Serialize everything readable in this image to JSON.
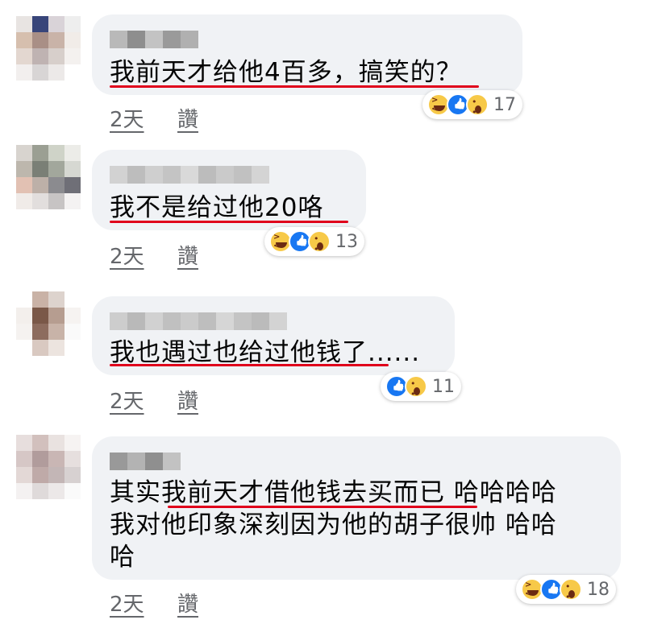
{
  "comments": [
    {
      "text": "我前天才给他4百多，搞笑的？",
      "time": "2天",
      "action": "讚",
      "reaction_count": "17",
      "reactions": [
        "haha-icon",
        "like-icon",
        "wow-icon"
      ]
    },
    {
      "text": "我不是给过他20咯",
      "time": "2天",
      "action": "讚",
      "reaction_count": "13",
      "reactions": [
        "haha-icon",
        "like-icon",
        "wow-icon"
      ]
    },
    {
      "text": "我也遇过也给过他钱了......",
      "time": "2天",
      "action": "讚",
      "reaction_count": "11",
      "reactions": [
        "like-icon",
        "wow-icon"
      ]
    },
    {
      "text_line1": "其实我前天才借他钱去买而已 哈哈哈哈",
      "text_line2": "我对他印象深刻因为他的胡子很帅 哈哈",
      "text_line3": "哈",
      "time": "2天",
      "action": "讚",
      "reaction_count": "18",
      "reactions": [
        "haha-icon",
        "like-icon",
        "wow-icon"
      ]
    }
  ],
  "colors": {
    "bubble": "#f0f2f5",
    "underline": "#e0001b",
    "meta": "#65676b",
    "like": "#1877f2"
  }
}
